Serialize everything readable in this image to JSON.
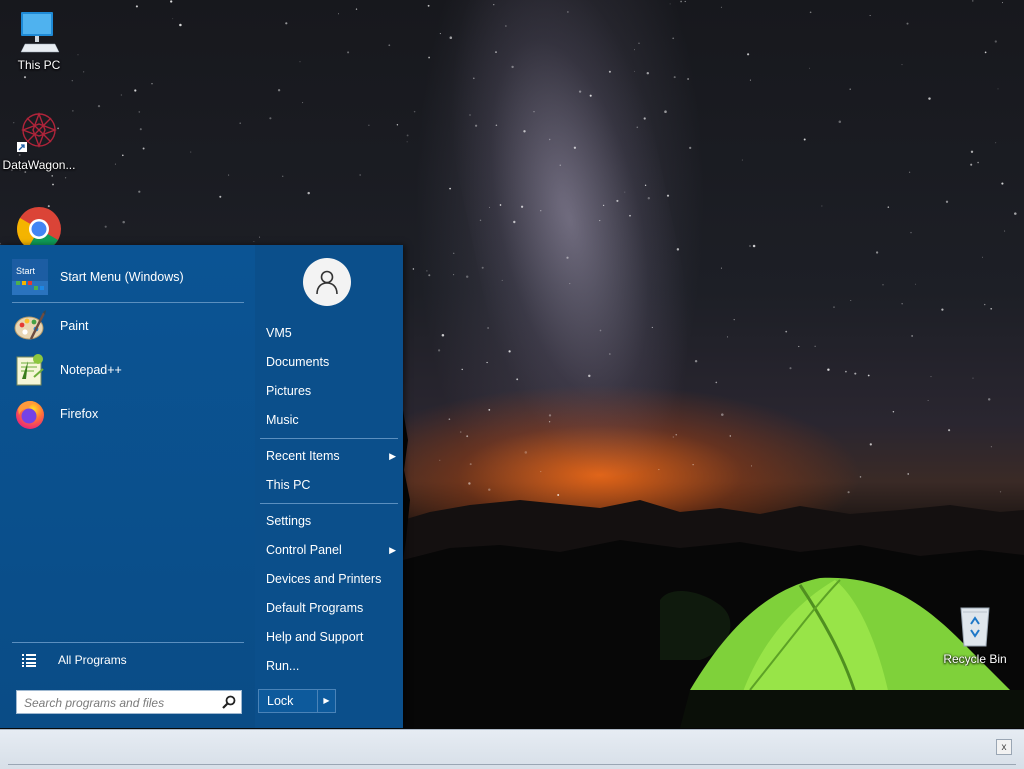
{
  "desktop": {
    "icons": [
      {
        "label": "This PC",
        "icon": "monitor-icon"
      },
      {
        "label": "DataWagon...",
        "icon": "datawagon-icon"
      },
      {
        "label": "",
        "icon": "chrome-icon"
      },
      {
        "label": "Recycle Bin",
        "icon": "recycle-bin-icon"
      }
    ]
  },
  "start_menu": {
    "pinned": [
      {
        "label": "Start Menu (Windows)",
        "icon": "start-menu-app-icon"
      },
      {
        "label": "Paint",
        "icon": "paint-icon"
      },
      {
        "label": "Notepad++",
        "icon": "notepadpp-icon"
      },
      {
        "label": "Firefox",
        "icon": "firefox-icon"
      }
    ],
    "start_tile_text": "Start",
    "all_programs_label": "All Programs",
    "search_placeholder": "Search programs and files",
    "user_name": "VM5",
    "right_items": [
      {
        "label": "Documents"
      },
      {
        "label": "Pictures"
      },
      {
        "label": "Music"
      },
      {
        "label": "Recent Items",
        "submenu": true
      },
      {
        "label": "This PC"
      },
      {
        "label": "Settings"
      },
      {
        "label": "Control Panel",
        "submenu": true
      },
      {
        "label": "Devices and Printers"
      },
      {
        "label": "Default Programs"
      },
      {
        "label": "Help and Support"
      },
      {
        "label": "Run..."
      }
    ],
    "submenu_arrow": "▶",
    "lock_label": "Lock",
    "lock_arrow": "▶"
  },
  "taskbar": {
    "close_label": "x"
  },
  "colors": {
    "menu_bg": "#0a4f8a",
    "separator": "#5b8fbf",
    "taskbar_bg": "#e1e8f0"
  }
}
